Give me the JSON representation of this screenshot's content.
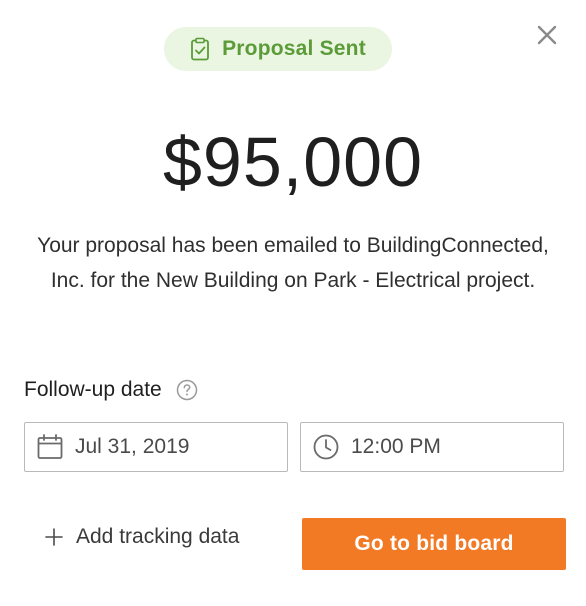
{
  "status": {
    "label": "Proposal Sent",
    "icon": "clipboard-check-icon",
    "bg_color": "#eaf5e2",
    "text_color": "#5b9c39"
  },
  "proposal": {
    "amount": "$95,000",
    "message": "Your proposal has been emailed to BuildingConnected, Inc. for the New Building on Park - Electrical project."
  },
  "followup": {
    "label": "Follow-up date",
    "help_icon": "question-circle-icon",
    "date_value": "Jul 31, 2019",
    "date_icon": "calendar-icon",
    "time_value": "12:00 PM",
    "time_icon": "clock-icon"
  },
  "actions": {
    "add_tracking_label": "Add tracking data",
    "add_tracking_icon": "plus-icon",
    "primary_label": "Go to bid board",
    "primary_color": "#f27a25"
  },
  "close_icon": "close-icon"
}
